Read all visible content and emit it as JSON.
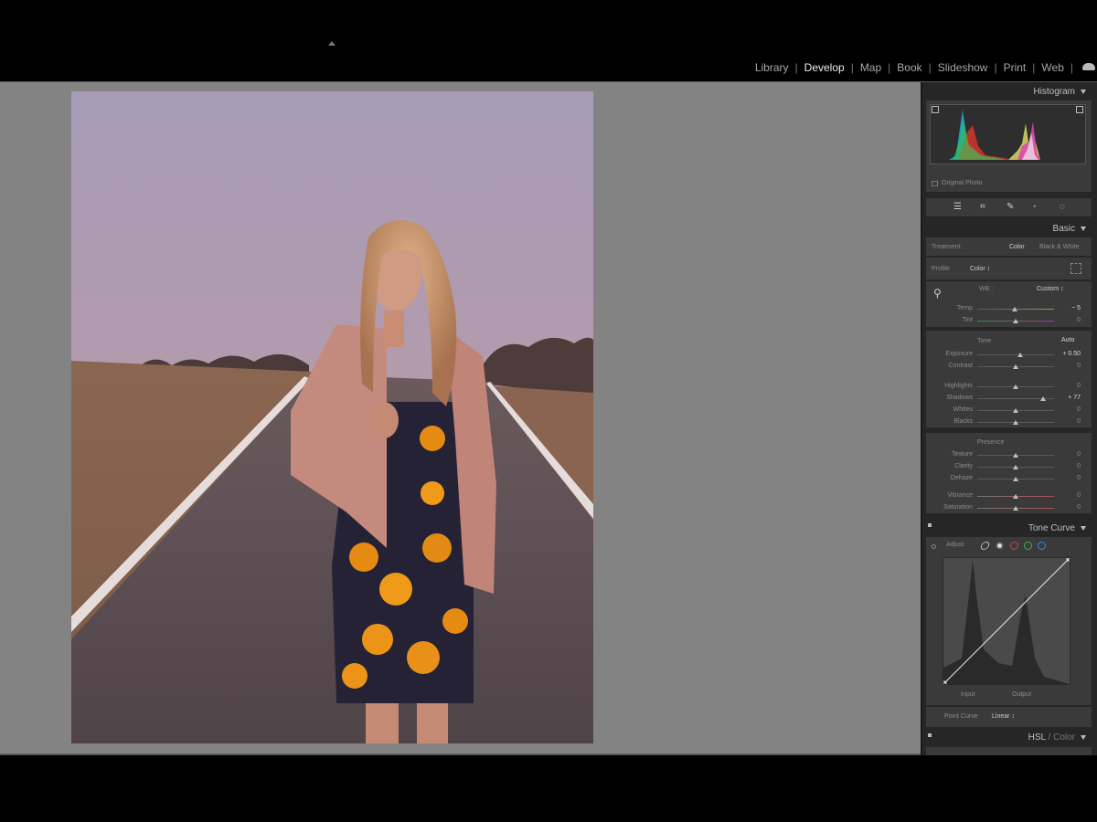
{
  "modules": [
    "Library",
    "Develop",
    "Map",
    "Book",
    "Slideshow",
    "Print",
    "Web"
  ],
  "active_module": "Develop",
  "panels": {
    "histogram": {
      "title": "Histogram",
      "original_photo": "Original Photo"
    },
    "basic": {
      "title": "Basic",
      "treatment_label": "Treatment",
      "treatment_color": "Color",
      "treatment_bw": "Black & White",
      "profile_label": "Profile",
      "profile_value": "Color ↕",
      "wb_label": "WB :",
      "wb_value": "Custom ↕",
      "temp_label": "Temp",
      "temp_value": "− 5",
      "tint_label": "Tint",
      "tint_value": "0",
      "tone_label": "Tone",
      "auto_label": "Auto",
      "exposure_label": "Exposure",
      "exposure_value": "+ 0.50",
      "contrast_label": "Contrast",
      "contrast_value": "0",
      "highlights_label": "Highlights",
      "highlights_value": "0",
      "shadows_label": "Shadows",
      "shadows_value": "+ 77",
      "whites_label": "Whites",
      "whites_value": "0",
      "blacks_label": "Blacks",
      "blacks_value": "0",
      "presence_label": "Presence",
      "texture_label": "Texture",
      "texture_value": "0",
      "clarity_label": "Clarity",
      "clarity_value": "0",
      "dehaze_label": "Dehaze",
      "dehaze_value": "0",
      "vibrance_label": "Vibrance",
      "vibrance_value": "0",
      "saturation_label": "Saturation",
      "saturation_value": "0"
    },
    "tone_curve": {
      "title": "Tone Curve",
      "adjust_label": "Adjust",
      "input_label": "Input",
      "output_label": "Output",
      "point_curve_label": "Point Curve",
      "point_curve_value": "Linear ↕"
    },
    "hsl": {
      "title_hsl": "HSL",
      "title_sep": " / ",
      "title_color": "Color"
    }
  },
  "colors": {
    "panel_bg": "#262626",
    "section_bg": "#3a3a3a",
    "canvas_bg": "#838383"
  }
}
